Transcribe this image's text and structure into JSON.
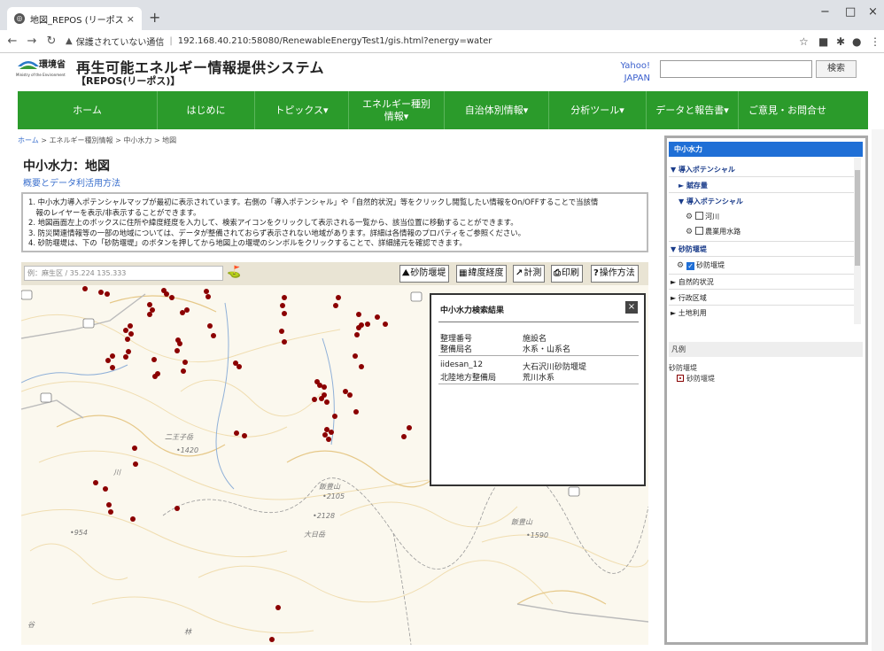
{
  "browser": {
    "tab_title": "地図_REPOS (リーポス (再生可能",
    "tab_close": "×",
    "new_tab": "+",
    "security_label": "保護されていない通信",
    "url": "192.168.40.210:58080/RenewableEnergyTest1/gis.html?energy=water",
    "minimize": "−",
    "maximize": "□",
    "close": "×"
  },
  "header": {
    "ministry": "環境省",
    "ministry_en": "Ministry of the Environment",
    "title": "再生可能エネルギー情報提供システム",
    "subtitle": "【REPOS(リーポス)】",
    "yahoo_line1": "Yahoo!",
    "yahoo_line2": "JAPAN",
    "search_button": "検索"
  },
  "nav": {
    "items": [
      "ホーム",
      "はじめに",
      "トピックス▾",
      "エネルギー種別情報▾",
      "自治体別情報▾",
      "分析ツール▾",
      "データと報告書▾",
      "ご意見・お問合せ"
    ]
  },
  "breadcrumb": {
    "home": "ホーム",
    "sep": " > ",
    "energy": "エネルギー種別情報",
    "hydro": "中小水力",
    "map": "地図"
  },
  "page": {
    "title": "中小水力：地図",
    "sublink": "概要とデータ利活用方法",
    "notes": [
      "1. 中小水力導入ポテンシャルマップが最初に表示されています。右側の「導入ポテンシャル」や「自然的状況」等をクリックし閲覧したい情報をOn/OFFすることで当該情",
      "　報のレイヤーを表示/非表示することができます。",
      "2. 地図画面左上のボックスに住所や緯度経度を入力して、検索アイコンをクリックして表示される一覧から、該当位置に移動することができます。",
      "3. 防災関連情報等の一部の地域については、データが整備されておらず表示されない地域があります。詳細は各情報のプロパティをご参照ください。",
      "4. 砂防堰堤は、下の「砂防堰堤」のボタンを押してから地図上の堰堤のシンボルをクリックすることで、詳細諸元を確認できます。"
    ]
  },
  "toolbar": {
    "coord_placeholder": "例：麻生区 / 35.224 135.333",
    "btn_sabo": "砂防堰堤",
    "btn_latlon": "緯度経度",
    "btn_measure": "計測",
    "btn_print": "印刷",
    "btn_help": "操作方法"
  },
  "map": {
    "labels": [
      "二王子岳",
      "•1420",
      "飯豊山",
      "•2105",
      "•2128",
      "大日岳",
      "•954",
      "飯豊山",
      "•1590",
      "川",
      "谷",
      "林"
    ]
  },
  "popup": {
    "title": "中小水力検索結果",
    "close": "×",
    "h1a": "整理番号",
    "h1b": "施設名",
    "h2a": "整備局名",
    "h2b": "水系・山系名",
    "r1a": "iidesan_12",
    "r1b": "大石沢川砂防堰堤",
    "r2a": "北陸地方整備局",
    "r2b": "荒川水系"
  },
  "sidebar": {
    "header": "中小水力",
    "potential": "▼ 導入ポテンシャル",
    "fuzon": "► 賦存量",
    "potential_sub": "▼ 導入ポテンシャル",
    "river": "河川",
    "agri": "農業用水路",
    "sabo_group": "▼ 砂防堰堤",
    "sabo": "砂防堰堤",
    "natural": "► 自然的状況",
    "admin": "► 行政区域",
    "landuse": "► 土地利用",
    "legend_head": "凡例",
    "legend_group": "砂防堰堤",
    "legend_item": "砂防堰堤"
  },
  "colors": {
    "nav_green": "#2b9b2b",
    "sidebar_blue": "#1f6fd6",
    "dam_marker": "#8b0000"
  }
}
